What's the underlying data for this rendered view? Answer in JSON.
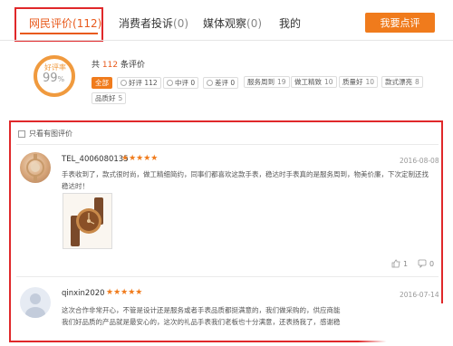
{
  "tabs": [
    {
      "label": "网民评价",
      "count": "(112)"
    },
    {
      "label": "消费者投诉",
      "count": "(0)"
    },
    {
      "label": "媒体观察",
      "count": "(0)"
    },
    {
      "label": "我的",
      "count": ""
    }
  ],
  "write_review": "我要点评",
  "summary": {
    "good_label": "好评率",
    "good_pct": "99",
    "good_pct_sign": "%",
    "total_prefix": "共",
    "total_count": "112",
    "total_suffix": "条评价",
    "filters": [
      {
        "label": "全部",
        "active": true
      },
      {
        "label": "好评 112"
      },
      {
        "label": "中评 0"
      },
      {
        "label": "差评 0"
      }
    ],
    "tags": [
      {
        "label": "服务周到",
        "count": "19"
      },
      {
        "label": "做工精致",
        "count": "10"
      },
      {
        "label": "质量好",
        "count": "10"
      },
      {
        "label": "款式漂亮",
        "count": "8"
      },
      {
        "label": "品质好",
        "count": "5"
      }
    ]
  },
  "filter_images_label": "只看有图评价",
  "reviews": [
    {
      "user": "TEL_4006080135",
      "stars": "★★★★★",
      "date": "2016-08-08",
      "text_line1": "手表收到了，款式很时尚，做工精细简约，同事们都喜欢这款手表，稳达时手表真的是服务周到，物美价廉，下次定制还找",
      "text_line2": "稳达时！",
      "likes": "1",
      "comments": "0"
    },
    {
      "user": "qinxin2020",
      "stars": "★★★★★",
      "date": "2016-07-14",
      "text_line1": "这次合作非常开心，不管是设计还是服务或者手表品质都挺满意的，我们做采购的，供应商能",
      "text_line2": "我们好品质的产品就是最安心的，这次的礼品手表我们老板也十分满意，还表扬我了，感谢稳"
    }
  ],
  "colors": {
    "accent": "#f07b1c",
    "highlight_box": "#e0282a"
  }
}
